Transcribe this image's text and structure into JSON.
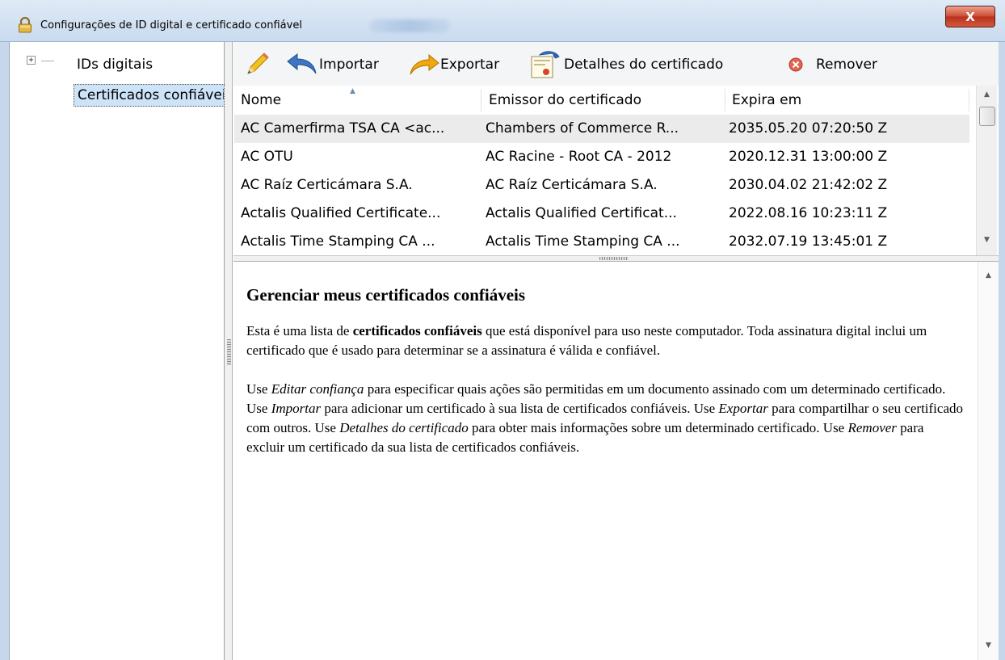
{
  "window": {
    "title": "Configurações de ID digital e certificado confiável",
    "close_label": "X"
  },
  "tree": {
    "expander": "+",
    "items": [
      {
        "label": "IDs digitais"
      },
      {
        "label": "Certificados confiáveis"
      }
    ]
  },
  "toolbar": {
    "import_label": "Importar",
    "export_label": "Exportar",
    "details_label": "Detalhes do certificado",
    "remove_label": "Remover"
  },
  "table": {
    "headers": [
      "Nome",
      "Emissor do certificado",
      "Expira em"
    ],
    "rows": [
      [
        "AC Camerfirma TSA CA <ac...",
        "Chambers of Commerce R...",
        "2035.05.20 07:20:50 Z"
      ],
      [
        "AC OTU",
        "AC Racine - Root CA - 2012",
        "2020.12.31 13:00:00 Z"
      ],
      [
        "AC Raíz Certicámara S.A.",
        "AC Raíz Certicámara S.A.",
        "2030.04.02 21:42:02 Z"
      ],
      [
        "Actalis Qualified Certificate...",
        "Actalis Qualified Certificat...",
        "2022.08.16 10:23:11 Z"
      ],
      [
        "Actalis Time Stamping CA ...",
        "Actalis Time Stamping CA ...",
        "2032.07.19 13:45:01 Z"
      ]
    ]
  },
  "description": {
    "heading": "Gerenciar meus certificados confiáveis",
    "p1_a": "Esta é uma lista de ",
    "p1_b": "certificados confiáveis",
    "p1_c": " que está disponível para uso neste computador. Toda assinatura digital inclui um certificado que é usado para determinar se a assinatura é válida e confiável.",
    "p2_a": "Use ",
    "p2_b": "Editar confiança",
    "p2_c": " para especificar quais ações são permitidas em um documento assinado com um determinado certificado. Use ",
    "p2_d": "Importar",
    "p2_e": " para adicionar um certificado à sua lista de certificados confiáveis. Use ",
    "p2_f": "Exportar",
    "p2_g": " para compartilhar o seu certificado com outros. Use ",
    "p2_h": "Detalhes do certificado",
    "p2_i": " para obter mais informações sobre um determinado certificado. Use ",
    "p2_j": "Remover",
    "p2_k": " para excluir um certificado da sua lista de certificados confiáveis."
  },
  "colors": {
    "selection": "#cde3f7",
    "titlebar": "#c9dbef",
    "close": "#cd4a33"
  }
}
